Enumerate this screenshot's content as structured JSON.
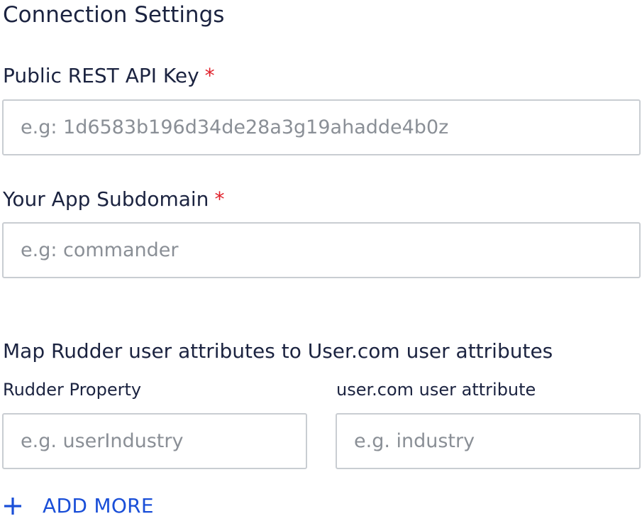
{
  "section": {
    "title": "Connection Settings"
  },
  "fields": {
    "api_key": {
      "label": "Public REST API Key",
      "required_mark": "*",
      "placeholder": "e.g: 1d6583b196d34de28a3g19ahadde4b0z",
      "value": ""
    },
    "subdomain": {
      "label": "Your App Subdomain",
      "required_mark": "*",
      "placeholder": "e.g: commander",
      "value": ""
    }
  },
  "mapping": {
    "title": "Map Rudder user attributes to User.com user attributes",
    "rudder_property_label": "Rudder Property",
    "usercom_attribute_label": "user.com user attribute",
    "rows": [
      {
        "rudder_placeholder": "e.g. userIndustry",
        "usercom_placeholder": "e.g. industry"
      }
    ],
    "add_more_label": "ADD MORE",
    "add_more_icon": "plus-icon"
  },
  "colors": {
    "text": "#1b2340",
    "required": "#e0202a",
    "accent": "#1a4fd8",
    "input_border": "#c9cdd2",
    "placeholder": "#8a8f96"
  }
}
